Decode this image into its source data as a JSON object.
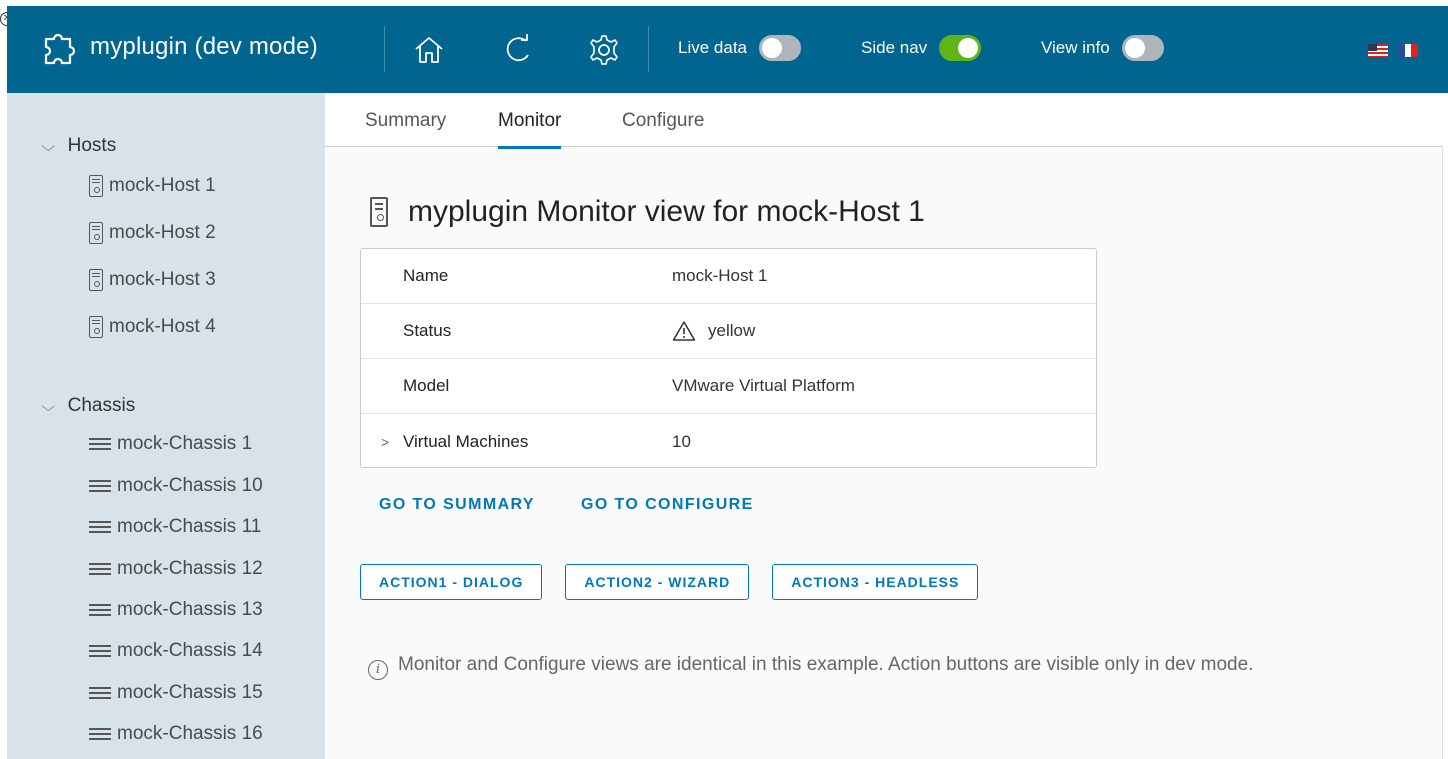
{
  "header": {
    "title": "myplugin (dev mode)",
    "toggles": [
      {
        "label": "Live data",
        "on": false
      },
      {
        "label": "Side nav",
        "on": true
      },
      {
        "label": "View info",
        "on": false
      }
    ],
    "icons": [
      "puzzle-icon",
      "home-icon",
      "refresh-icon",
      "gear-icon",
      "us-flag-icon",
      "fr-flag-icon"
    ]
  },
  "sidebar": {
    "hosts": {
      "label": "Hosts",
      "items": [
        "mock-Host 1",
        "mock-Host 2",
        "mock-Host 3",
        "mock-Host 4"
      ]
    },
    "chassis": {
      "label": "Chassis",
      "items": [
        "mock-Chassis 1",
        "mock-Chassis 10",
        "mock-Chassis 11",
        "mock-Chassis 12",
        "mock-Chassis 13",
        "mock-Chassis 14",
        "mock-Chassis 15",
        "mock-Chassis 16"
      ]
    }
  },
  "tabs": [
    {
      "label": "Summary",
      "active": false
    },
    {
      "label": "Monitor",
      "active": true
    },
    {
      "label": "Configure",
      "active": false
    }
  ],
  "main": {
    "title": "myplugin Monitor view for mock-Host 1",
    "details": [
      {
        "key": "Name",
        "value": "mock-Host 1"
      },
      {
        "key": "Status",
        "value": "yellow"
      },
      {
        "key": "Model",
        "value": "VMware Virtual Platform"
      },
      {
        "key": "Virtual Machines",
        "value": "10"
      }
    ],
    "links": [
      "GO TO SUMMARY",
      "GO TO CONFIGURE"
    ],
    "actions": [
      "ACTION1 - DIALOG",
      "ACTION2 - WIZARD",
      "ACTION3 - HEADLESS"
    ],
    "info_text": "Monitor and Configure views are identical in this example. Action buttons are visible only in dev mode."
  },
  "colors": {
    "header_bg": "#00668f",
    "sidebar_bg": "#d8e3e9",
    "accent": "#0079b8",
    "toggle_on": "#60b515",
    "warning": "#333333"
  }
}
